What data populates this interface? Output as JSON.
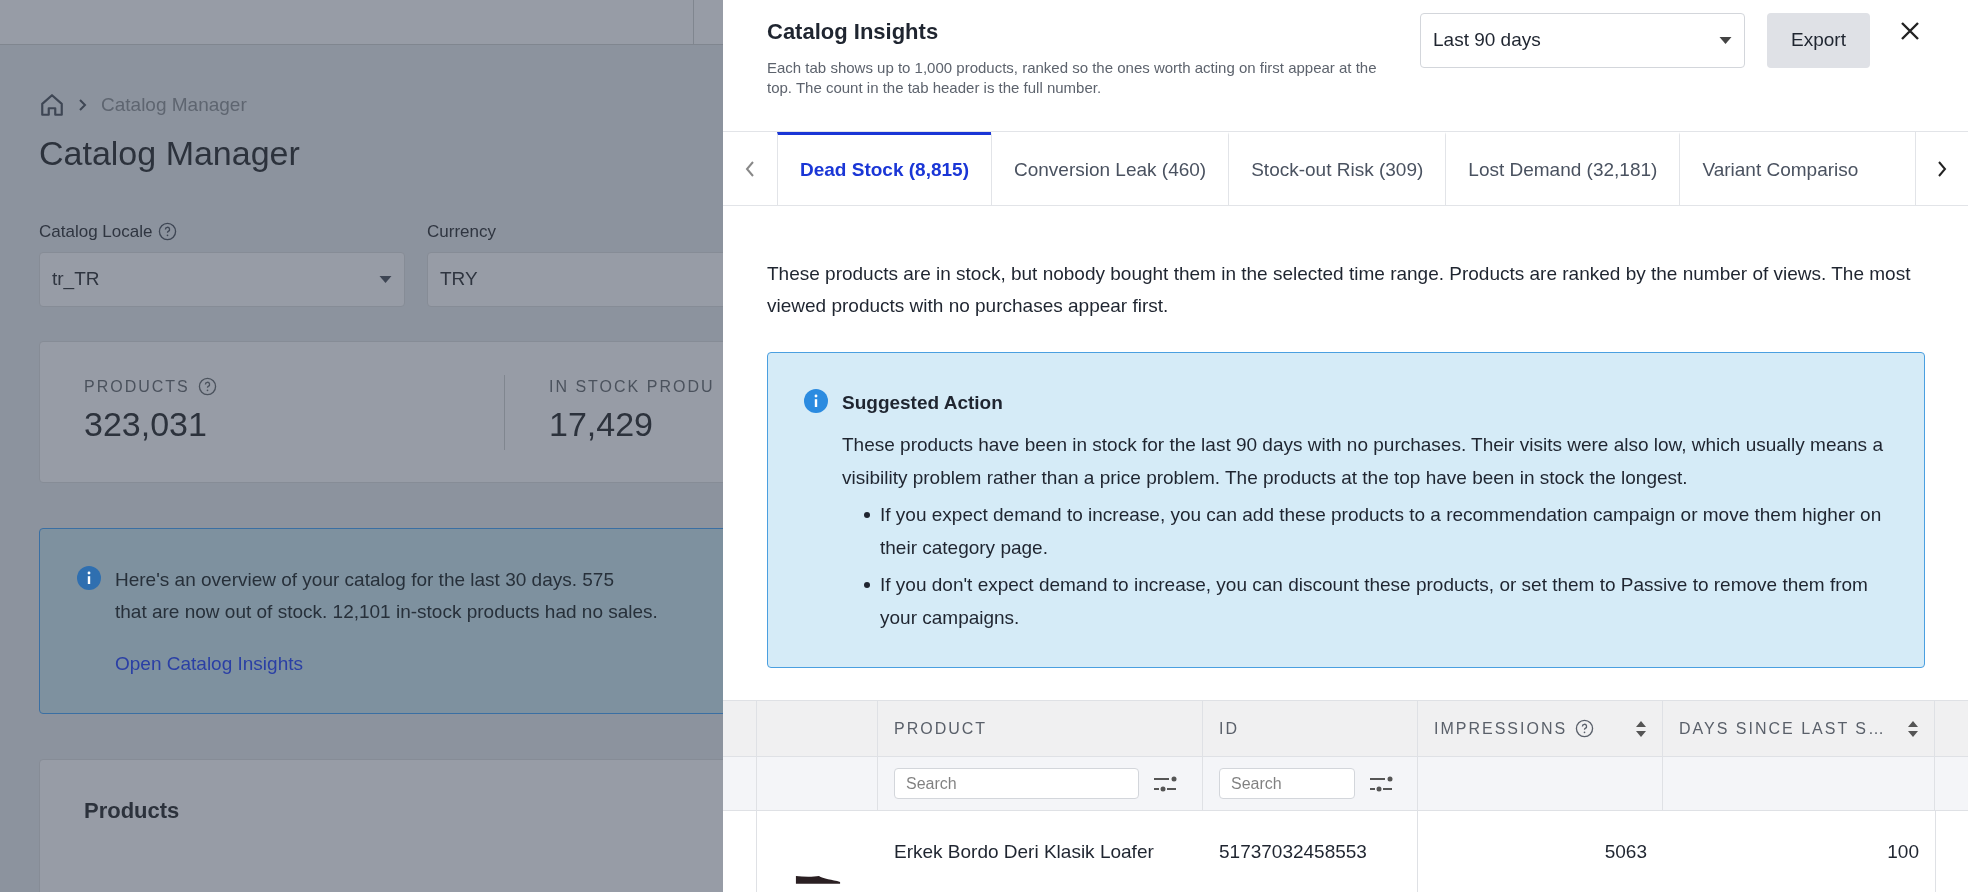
{
  "page": {
    "breadcrumb": [
      "Catalog Manager"
    ],
    "title": "Catalog Manager",
    "fields": [
      {
        "label": "Catalog Locale",
        "help": true,
        "value": "tr_TR",
        "dropdown": true
      },
      {
        "label": "Currency",
        "value": "TRY"
      }
    ],
    "stats": [
      {
        "label": "PRODUCTS",
        "help": true,
        "value": "323,031"
      },
      {
        "label": "IN STOCK PRODU",
        "value": "17,429"
      }
    ],
    "notice": {
      "text": "Here's an overview of your catalog for the last 30 days. 575",
      "text_2": "that are now out of stock. 12,101 in-stock products had no sales.",
      "link": "Open Catalog Insights"
    },
    "products_card": {
      "title": "Products"
    }
  },
  "drawer": {
    "title": "Catalog Insights",
    "subtitle": "Each tab shows up to 1,000 products, ranked so the ones worth acting on first appear at the top. The count in the tab header is the full number.",
    "range": {
      "value": "Last 90 days"
    },
    "export": "Export",
    "tabs": [
      {
        "label": "Dead Stock (8,815)",
        "selected": true
      },
      {
        "label": "Conversion Leak (460)",
        "selected": false
      },
      {
        "label": "Stock-out Risk (309)",
        "selected": false
      },
      {
        "label": "Lost Demand (32,181)",
        "selected": false
      },
      {
        "label": "Variant Compariso",
        "selected": false
      }
    ],
    "description": "These products are in stock, but nobody bought them in the selected time range. Products are ranked by the number of views. The most viewed products with no purchases appear first.",
    "suggestion": {
      "title": "Suggested Action",
      "text": "These products have been in stock for the last 90 days with no purchases. Their visits were also low, which usually means a visibility problem rather than a price problem. The products at the top have been in stock the longest.",
      "bullets": [
        "If you expect demand to increase, you can add these products to a recommendation campaign or move them higher on their category page.",
        "If you don't expect demand to increase, you can discount these products, or set them to Passive to remove them from your campaigns."
      ]
    },
    "table": {
      "columns": [
        {
          "label": "PRODUCT",
          "placeholder": "Search"
        },
        {
          "label": "ID",
          "placeholder": "Search"
        },
        {
          "label": "IMPRESSIONS",
          "help": true,
          "sortable": true
        },
        {
          "label": "DAYS SINCE LAST S…",
          "sortable": true
        }
      ],
      "rows": [
        {
          "cells": [
            "Erkek Bordo Deri Klasik Loafer",
            "51737032458553",
            "5063",
            "100"
          ]
        }
      ]
    }
  }
}
